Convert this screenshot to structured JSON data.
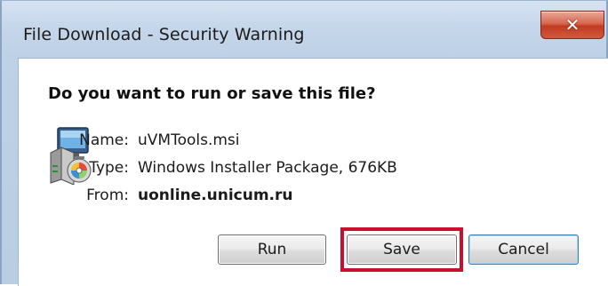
{
  "window": {
    "title": "File Download - Security Warning",
    "close_glyph": "✕"
  },
  "dialog": {
    "question": "Do you want to run or save this file?",
    "file_icon": "windows-installer-package-icon",
    "fields": {
      "name_label": "Name:",
      "name_value": "uVMTools.msi",
      "type_label": "Type:",
      "type_value": "Windows Installer Package, 676KB",
      "from_label": "From:",
      "from_value": "uonline.unicum.ru"
    }
  },
  "buttons": {
    "run_label": "Run",
    "save_label": "Save",
    "cancel_label": "Cancel"
  },
  "annotation": {
    "highlight_target": "save-button",
    "highlight_color": "#c8102e"
  },
  "colors": {
    "close_button": "#c23b22",
    "window_frame": "#bfd1e6"
  }
}
